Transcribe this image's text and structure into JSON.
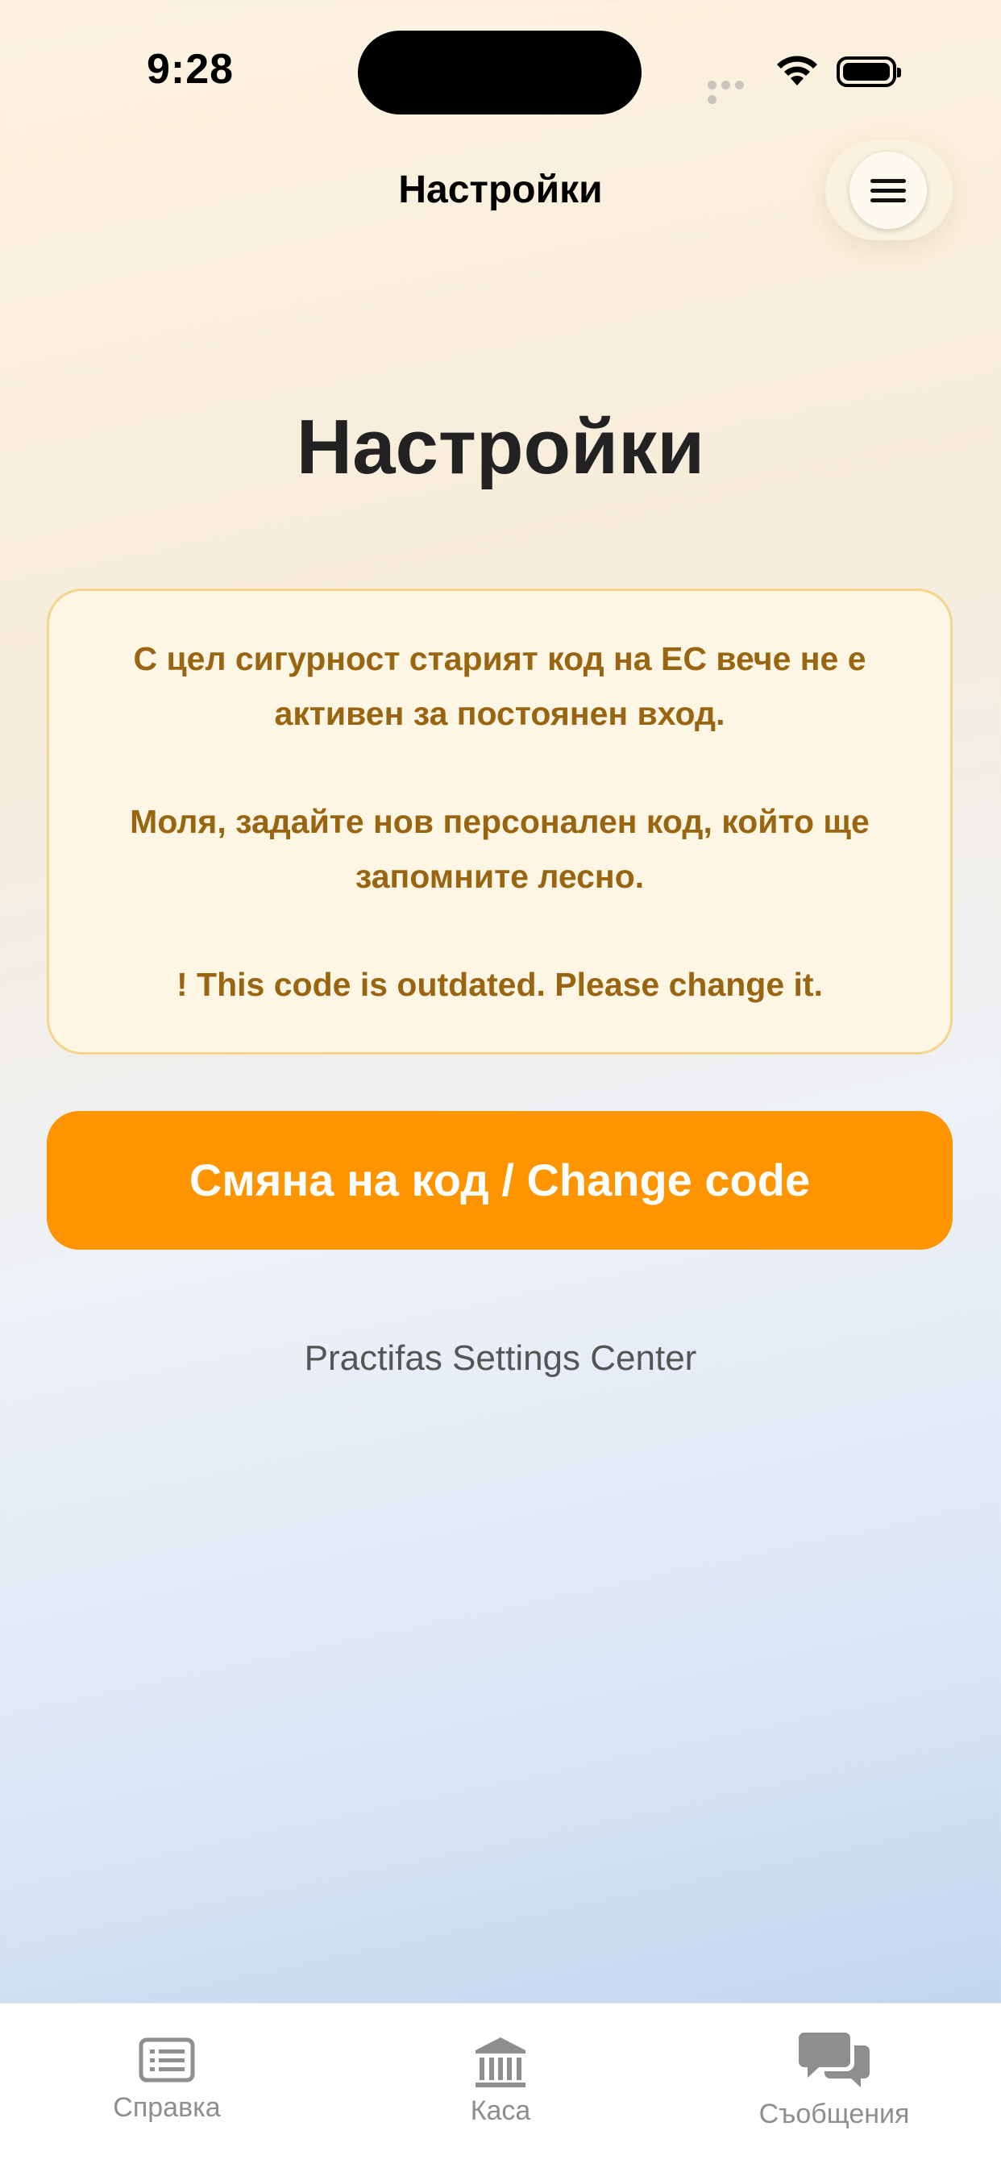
{
  "status_bar": {
    "time": "9:28"
  },
  "nav": {
    "title": "Настройки"
  },
  "page": {
    "title": "Настройки"
  },
  "notice": {
    "line1": "С цел сигурност старият код на ЕС вече не е активен за постоянен вход.",
    "line2": "Моля, задайте нов персонален код, който ще запомните лесно.",
    "line3": "! This code is outdated. Please change it."
  },
  "actions": {
    "change_code_label": "Смяна на код / Change code"
  },
  "footer": {
    "text": "Practifas Settings Center"
  },
  "tabs": [
    {
      "label": "Справка",
      "icon": "list-icon"
    },
    {
      "label": "Каса",
      "icon": "bank-icon"
    },
    {
      "label": "Съобщения",
      "icon": "chat-icon"
    }
  ],
  "colors": {
    "accent": "#fe9500",
    "notice_text": "#9a6510",
    "notice_bg": "#fef6e4",
    "notice_border": "#f5d48c"
  }
}
